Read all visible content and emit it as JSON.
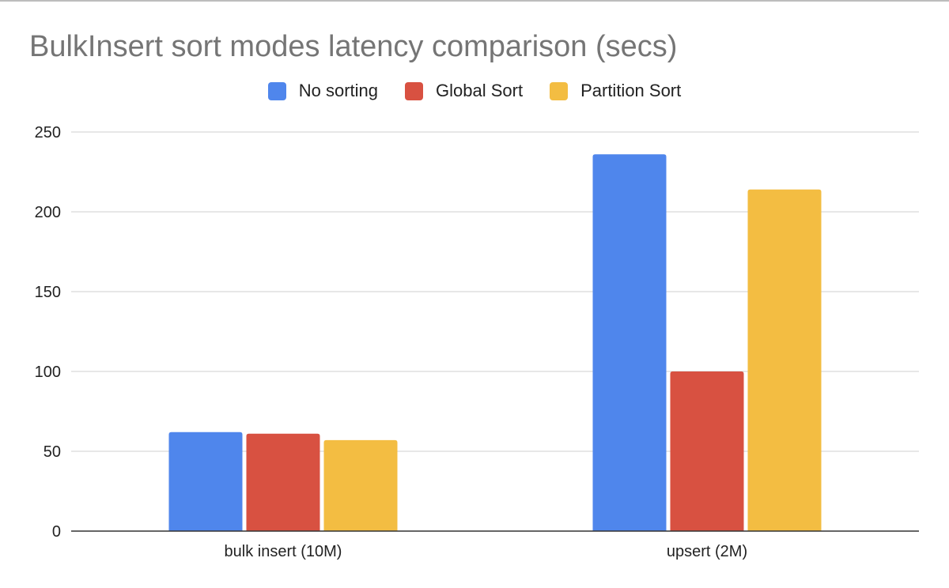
{
  "chart_data": {
    "type": "bar",
    "title": "BulkInsert sort modes latency comparison (secs)",
    "xlabel": "",
    "ylabel": "",
    "categories": [
      "bulk insert (10M)",
      "upsert (2M)"
    ],
    "series": [
      {
        "name": "No sorting",
        "color": "#4f86ec",
        "values": [
          62,
          236
        ]
      },
      {
        "name": "Global Sort",
        "color": "#d85141",
        "values": [
          61,
          100
        ]
      },
      {
        "name": "Partition Sort",
        "color": "#f3bd42",
        "values": [
          57,
          214
        ]
      }
    ],
    "ylim": [
      0,
      250
    ],
    "yticks": [
      0,
      50,
      100,
      150,
      200,
      250
    ],
    "grid": true,
    "legend_position": "top"
  }
}
